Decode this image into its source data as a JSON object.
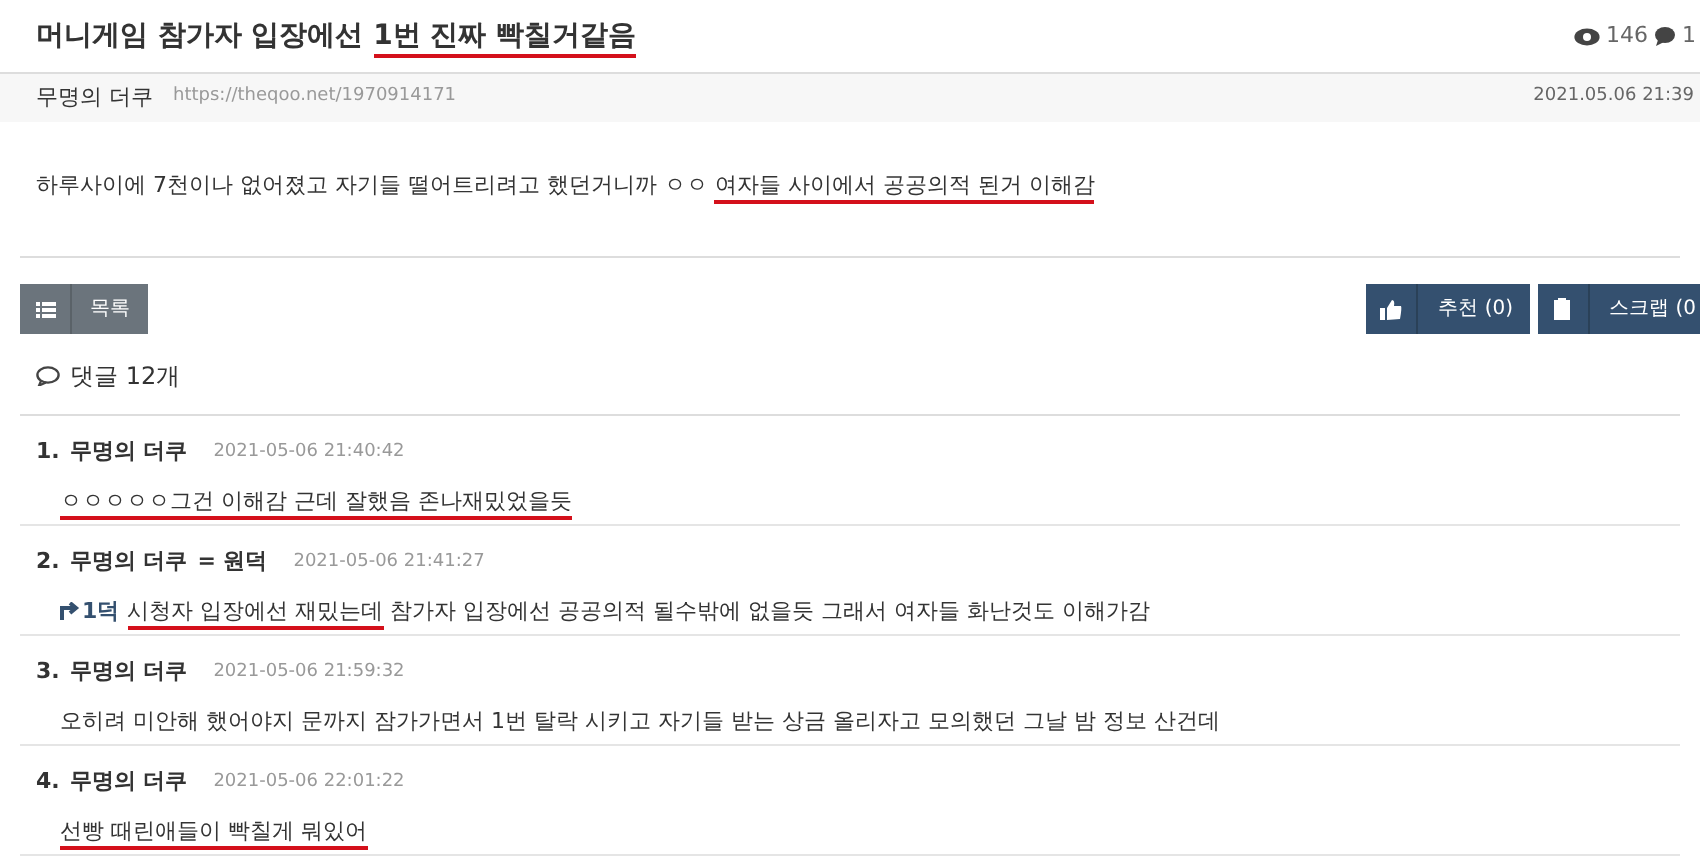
{
  "post": {
    "title": [
      {
        "text": "머니게임 참가자 입장에선 ",
        "underlined": false
      },
      {
        "text": "1번 진짜 빡칠거같음",
        "underlined": true
      }
    ],
    "views": "146",
    "comments_count": "1",
    "author": "무명의 더쿠",
    "url": "https://theqoo.net/1970914171",
    "date": "2021.05.06 21:39",
    "body": [
      {
        "text": "하루사이에 7천이나 없어졌고 자기들 떨어트리려고 했던거니까 ㅇㅇ ",
        "underlined": false
      },
      {
        "text": "여자들 사이에서 공공의적 된거 이해감",
        "underlined": true
      }
    ]
  },
  "buttons": {
    "list": "목록",
    "recommend": "추천 (0)",
    "scrap": "스크랩 (0"
  },
  "comments_header": "댓글 12개",
  "comments": [
    {
      "number": "1.",
      "author": "무명의 더쿠",
      "time": "2021-05-06 21:40:42",
      "body": [
        {
          "text": "ㅇㅇㅇㅇㅇ그건 이해감 근데 잘했음 존나재밌었을듯",
          "underlined": true
        }
      ]
    },
    {
      "number": "2.",
      "author": "무명의 더쿠",
      "reply_to": "= 원덕",
      "time": "2021-05-06 21:41:27",
      "reply_ref": "1덕",
      "body": [
        {
          "text": "시청자 입장에선 재밌는데",
          "underlined": true
        },
        {
          "text": " 참가자 입장에선 공공의적 될수밖에 없을듯 그래서 여자들 화난것도 이해가감",
          "underlined": false
        }
      ]
    },
    {
      "number": "3.",
      "author": "무명의 더쿠",
      "time": "2021-05-06 21:59:32",
      "body": [
        {
          "text": "오히려 미안해 했어야지 문까지 잠가가면서 1번 탈락 시키고 자기들 받는 상금 올리자고 모의했던 그날 밤 정보 산건데",
          "underlined": false
        }
      ]
    },
    {
      "number": "4.",
      "author": "무명의 더쿠",
      "time": "2021-05-06 22:01:22",
      "body": [
        {
          "text": "선빵 때린애들이 빡칠게 뭐있어",
          "underlined": true
        }
      ]
    }
  ]
}
